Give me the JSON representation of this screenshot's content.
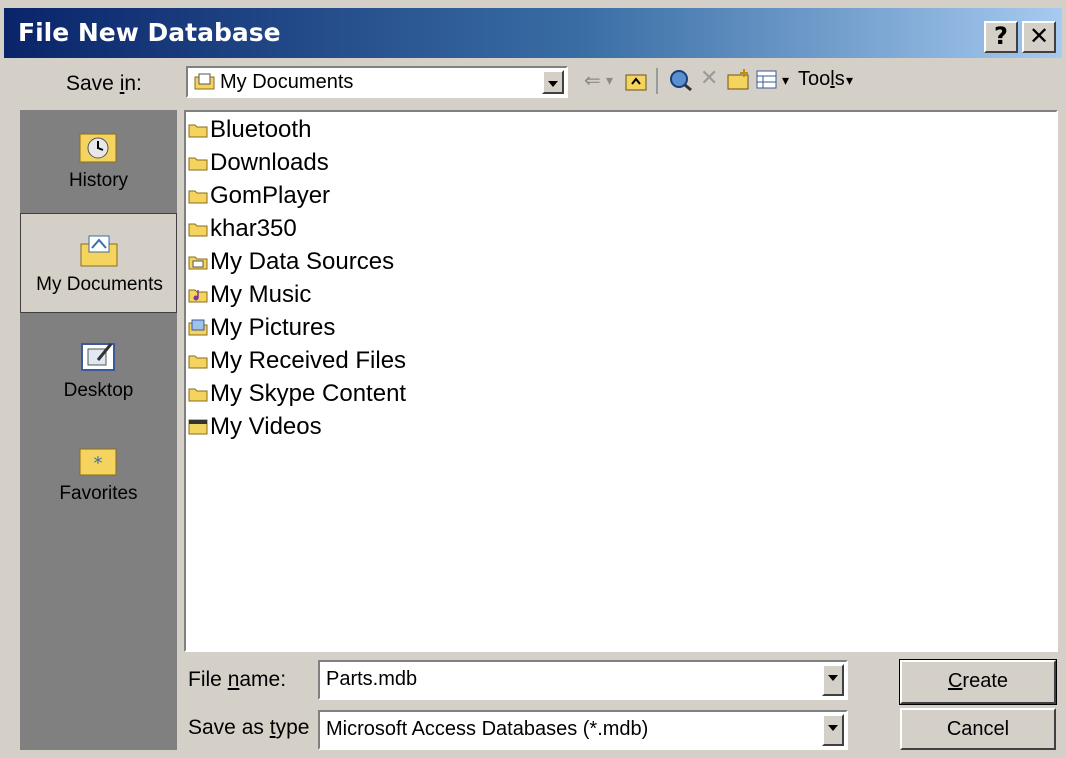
{
  "window": {
    "title": "File New Database",
    "help_label": "?",
    "close_label": "✕"
  },
  "save_in": {
    "label": "Save in:",
    "value": "My Documents"
  },
  "toolbar": {
    "back": "⇐",
    "back_dd": "▾",
    "tools_label": "Tools"
  },
  "places": [
    {
      "label": "History",
      "icon": "history-icon"
    },
    {
      "label": "My Documents",
      "icon": "my-documents-icon",
      "selected": true
    },
    {
      "label": "Desktop",
      "icon": "desktop-icon"
    },
    {
      "label": "Favorites",
      "icon": "favorites-icon"
    }
  ],
  "files": [
    {
      "name": "Bluetooth",
      "icon": "folder-icon"
    },
    {
      "name": "Downloads",
      "icon": "folder-icon"
    },
    {
      "name": "GomPlayer",
      "icon": "folder-icon"
    },
    {
      "name": "khar350",
      "icon": "folder-icon"
    },
    {
      "name": "My Data Sources",
      "icon": "data-sources-folder-icon"
    },
    {
      "name": "My Music",
      "icon": "music-folder-icon"
    },
    {
      "name": "My Pictures",
      "icon": "pictures-folder-icon"
    },
    {
      "name": "My Received Files",
      "icon": "folder-icon"
    },
    {
      "name": "My Skype Content",
      "icon": "folder-icon"
    },
    {
      "name": "My Videos",
      "icon": "videos-folder-icon"
    }
  ],
  "file_name": {
    "label": "File name:",
    "value": "Parts.mdb"
  },
  "save_as_type": {
    "label": "Save as type",
    "value": "Microsoft Access Databases (*.mdb)"
  },
  "buttons": {
    "create": "Create",
    "cancel": "Cancel"
  },
  "colors": {
    "title_start": "#0a246a",
    "title_end": "#a6caf0",
    "face": "#d4d0c8",
    "folder": "#f4d35e"
  }
}
